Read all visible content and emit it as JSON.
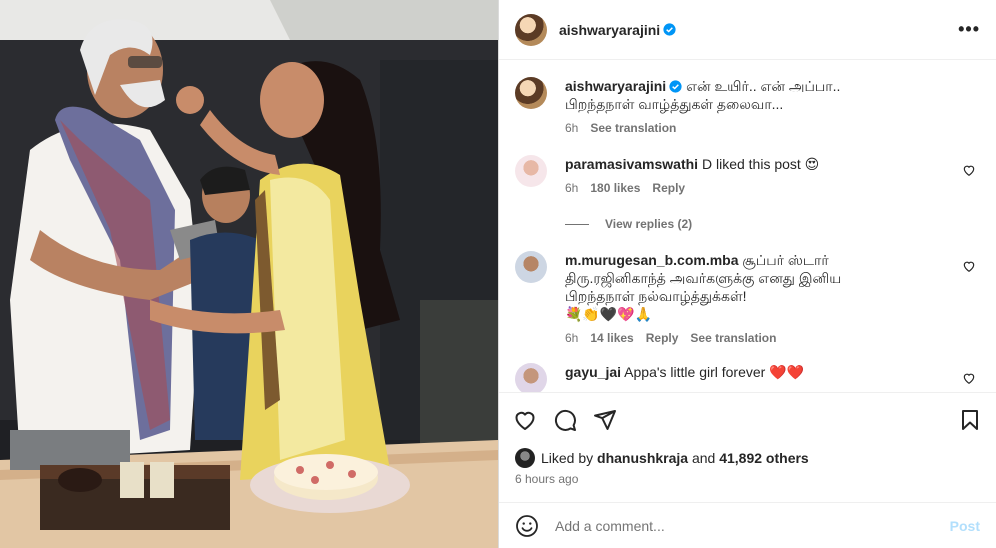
{
  "post": {
    "author": "aishwaryarajini",
    "caption_line1": "என் உயிர்.. என் அப்பா..",
    "caption_line2": "பிறந்தநாள் வாழ்த்துகள் தலைவா...",
    "caption_time": "6h",
    "see_translation": "See translation"
  },
  "comments": [
    {
      "user": "paramasivamswathi",
      "text": "D liked this post 😍",
      "time": "6h",
      "likes": "180 likes",
      "reply": "Reply",
      "view_replies": "View replies (2)"
    },
    {
      "user": "m.murugesan_b.com.mba",
      "text_line1": "சூப்பர் ஸ்டார்",
      "text_line2": "திரு.ரஜினிகாந்த் அவர்களுக்கு எனது இனிய",
      "text_line3": "பிறந்தநாள் நல்வாழ்த்துக்கள்!",
      "emoji": "💐👏🖤💖🙏",
      "time": "6h",
      "likes": "14 likes",
      "reply": "Reply",
      "see_translation": "See translation"
    },
    {
      "user": "gayu_jai",
      "text": "Appa's little girl forever ❤️❤️"
    }
  ],
  "likes": {
    "prefix": "Liked by",
    "user": "dhanushkraja",
    "and": "and",
    "others": "41,892 others"
  },
  "time_ago": "6 hours ago",
  "add_comment": {
    "placeholder": "Add a comment...",
    "post_label": "Post"
  },
  "colors": {
    "verified": "#0095f6",
    "post_disabled": "#b2dffc",
    "meta": "#737373"
  },
  "icons": [
    "more-icon",
    "verified-icon",
    "heart-icon",
    "comment-icon",
    "share-icon",
    "bookmark-icon",
    "emoji-icon"
  ]
}
